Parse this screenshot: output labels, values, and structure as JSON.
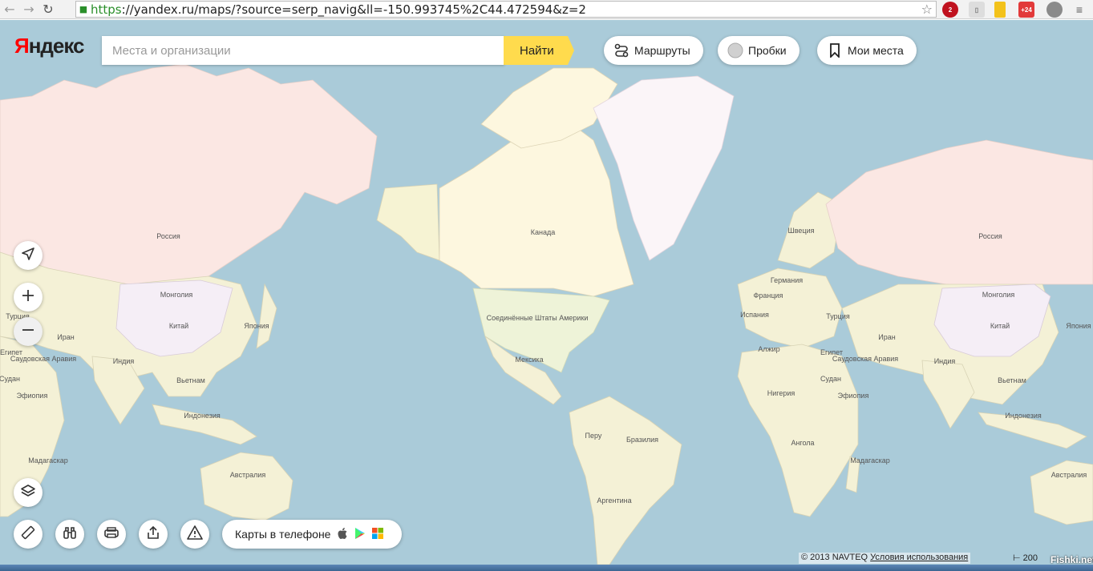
{
  "browser": {
    "url_scheme": "https",
    "url_rest": "://yandex.ru/maps/?source=serp_navig&ll=-150.993745%2C44.472594&z=2",
    "ext_abp_badge": "2",
    "ext_weather_badge": "+24"
  },
  "header": {
    "logo_first": "Я",
    "logo_rest": "ндекс",
    "search_placeholder": "Места и организации",
    "search_button": "Найти",
    "routes_label": "Маршруты",
    "traffic_label": "Пробки",
    "my_places_label": "Мои места"
  },
  "map": {
    "labels": [
      {
        "text": "Россия",
        "name": "label-russia-1"
      },
      {
        "text": "Монголия",
        "name": "label-mongolia-1"
      },
      {
        "text": "Турция",
        "name": "label-turkey-1"
      },
      {
        "text": "Иран",
        "name": "label-iran-1"
      },
      {
        "text": "Китай",
        "name": "label-china-1"
      },
      {
        "text": "Япония",
        "name": "label-japan-1"
      },
      {
        "text": "Египет",
        "name": "label-egypt-1"
      },
      {
        "text": "Саудовская Аравия",
        "name": "label-saudi-1"
      },
      {
        "text": "Индия",
        "name": "label-india-1"
      },
      {
        "text": "Судан",
        "name": "label-sudan-1"
      },
      {
        "text": "Вьетнам",
        "name": "label-vietnam-1"
      },
      {
        "text": "Эфиопия",
        "name": "label-ethiopia-1"
      },
      {
        "text": "Индонезия",
        "name": "label-indonesia-1"
      },
      {
        "text": "Мадагаскар",
        "name": "label-madagascar-1"
      },
      {
        "text": "Австралия",
        "name": "label-australia-1"
      },
      {
        "text": "Канада",
        "name": "label-canada"
      },
      {
        "text": "Соединённые Штаты Америки",
        "name": "label-usa"
      },
      {
        "text": "Мексика",
        "name": "label-mexico"
      },
      {
        "text": "Перу",
        "name": "label-peru"
      },
      {
        "text": "Бразилия",
        "name": "label-brazil"
      },
      {
        "text": "Аргентина",
        "name": "label-argentina"
      },
      {
        "text": "Швеция",
        "name": "label-sweden"
      },
      {
        "text": "Германия",
        "name": "label-germany"
      },
      {
        "text": "Франция",
        "name": "label-france"
      },
      {
        "text": "Испания",
        "name": "label-spain"
      },
      {
        "text": "Алжир",
        "name": "label-algeria"
      },
      {
        "text": "Нигерия",
        "name": "label-nigeria"
      },
      {
        "text": "Ангола",
        "name": "label-angola"
      },
      {
        "text": "Россия",
        "name": "label-russia-2"
      },
      {
        "text": "Монголия",
        "name": "label-mongolia-2"
      },
      {
        "text": "Турция",
        "name": "label-turkey-2"
      },
      {
        "text": "Египет",
        "name": "label-egypt-2"
      },
      {
        "text": "Саудовская Аравия",
        "name": "label-saudi-2"
      },
      {
        "text": "Иран",
        "name": "label-iran-2"
      },
      {
        "text": "Китай",
        "name": "label-china-2"
      },
      {
        "text": "Япония",
        "name": "label-japan-2"
      },
      {
        "text": "Индия",
        "name": "label-india-2"
      },
      {
        "text": "Судан",
        "name": "label-sudan-2"
      },
      {
        "text": "Эфиопия",
        "name": "label-ethiopia-2"
      },
      {
        "text": "Вьетнам",
        "name": "label-vietnam-2"
      },
      {
        "text": "Индонезия",
        "name": "label-indonesia-2"
      },
      {
        "text": "Мадагаскар",
        "name": "label-madagascar-2"
      },
      {
        "text": "Австралия",
        "name": "label-australia-2"
      }
    ]
  },
  "footer": {
    "apps_label": "Карты в телефоне",
    "copyright": "© 2013 NAVTEQ",
    "terms": "Условия использования",
    "scale": "200",
    "watermark": "Fishki.net"
  },
  "icons": {
    "back": "back-arrow-icon",
    "forward": "forward-arrow-icon",
    "reload": "reload-icon",
    "star": "star-icon",
    "locate": "locate-icon",
    "zoom_in": "plus-icon",
    "zoom_out": "minus-icon",
    "layers": "layers-icon",
    "ruler": "ruler-icon",
    "panorama": "binoculars-icon",
    "print": "printer-icon",
    "share": "share-icon",
    "report": "warning-icon",
    "apple": "apple-icon",
    "google_play": "google-play-icon",
    "windows": "windows-icon"
  },
  "colors": {
    "water": "#aacbd9",
    "land": "#f6f3d3",
    "russia": "#fbe7e3",
    "canada": "#fdf7df",
    "usa": "#eef3d8",
    "greenland": "#fbf5f8",
    "china": "#f5eef6",
    "accent_yellow": "#ffdb4d",
    "logo_red": "#ff0000"
  }
}
